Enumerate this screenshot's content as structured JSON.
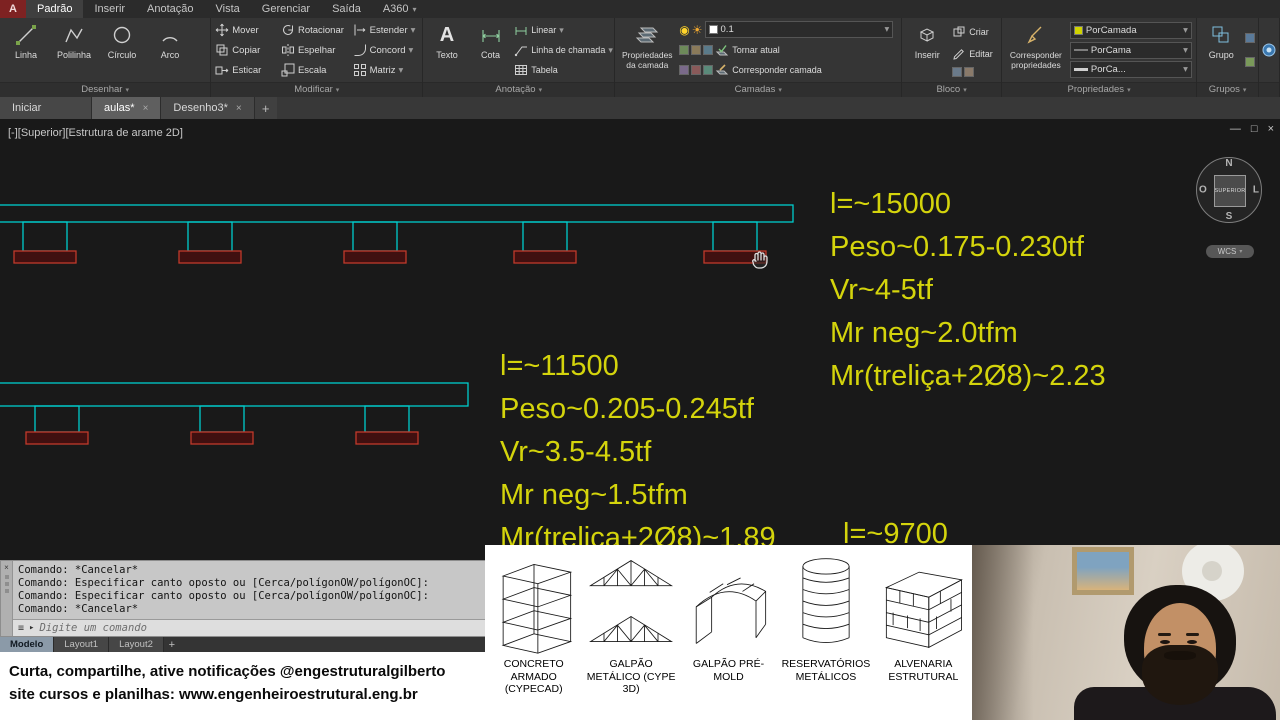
{
  "icons": {
    "close": "×",
    "caret": "▾",
    "minimize": "—",
    "restore": "□",
    "plus": "+"
  },
  "ribbon": {
    "tabs": [
      {
        "label": "Padrão"
      },
      {
        "label": "Inserir"
      },
      {
        "label": "Anotação"
      },
      {
        "label": "Vista"
      },
      {
        "label": "Gerenciar"
      },
      {
        "label": "Saída"
      },
      {
        "label": "A360"
      }
    ],
    "panels": {
      "desenhar": {
        "label": "Desenhar",
        "linha": "Linha",
        "polilinha": "Polilinha",
        "circulo": "Círculo",
        "arco": "Arco"
      },
      "modificar": {
        "label": "Modificar",
        "mover": "Mover",
        "copiar": "Copiar",
        "esticar": "Esticar",
        "rotacionar": "Rotacionar",
        "espelhar": "Espelhar",
        "escala": "Escala",
        "estender": "Estender",
        "concord": "Concord",
        "matriz": "Matriz"
      },
      "anotacao": {
        "label": "Anotação",
        "texto": "Texto",
        "cota": "Cota",
        "linear": "Linear",
        "linha_chamada": "Linha de chamada",
        "tabela": "Tabela"
      },
      "camadas": {
        "label": "Camadas",
        "propriedades_camada": "Propriedades da camada",
        "layer_value": "0.1",
        "tornar_atual": "Tornar atual",
        "corresponder_camada": "Corresponder camada"
      },
      "bloco": {
        "label": "Bloco",
        "inserir": "Inserir",
        "criar": "Criar",
        "editar": "Editar"
      },
      "propriedades": {
        "label": "Propriedades",
        "corresponder_propriedades": "Corresponder propriedades",
        "cor": "PorCamada",
        "tipo_linha": "PorCama",
        "espessura": "PorCa..."
      },
      "grupos": {
        "label": "Grupos",
        "grupo": "Grupo"
      }
    }
  },
  "file_tabs": [
    {
      "label": "Iniciar"
    },
    {
      "label": "aulas*"
    },
    {
      "label": "Desenho3*"
    }
  ],
  "viewport": {
    "collapse": "[-]",
    "view": "[Superior]",
    "visual_style": "[Estrutura de arame 2D]"
  },
  "canvas": {
    "annotations_right": [
      "l=~15000",
      "Peso~0.175-0.230tf",
      "Vr~4-5tf",
      "Mr neg~2.0tfm",
      "Mr(treliça+2Ø8)~2.23"
    ],
    "annotations_mid": [
      "l=~11500",
      "Peso~0.205-0.245tf",
      "Vr~3.5-4.5tf",
      "Mr neg~1.5tfm",
      "Mr(treliça+2Ø8)~1.89"
    ],
    "annotation_bottom": "l=~9700",
    "compass": {
      "n": "N",
      "s": "S",
      "l": "L",
      "o": "O",
      "cube": "SUPERIOR",
      "wcs": "WCS"
    }
  },
  "command": {
    "history": [
      "Comando: *Cancelar*",
      "Comando: Especificar canto oposto ou [Cerca/polígonOW/polígonOC]:",
      "Comando: Especificar canto oposto ou [Cerca/polígonOW/polígonOC]:",
      "Comando: *Cancelar*"
    ],
    "prompt": "Digite um comando"
  },
  "layout_tabs": {
    "modelo": "Modelo",
    "layout1": "Layout1",
    "layout2": "Layout2",
    "add": "+"
  },
  "banner": {
    "line1": "Curta, compartilhe, ative notificações @engestruturalgilberto",
    "line2": "site cursos e planilhas: www.engenheiroestrutural.eng.br"
  },
  "services": [
    {
      "caption": "CONCRETO ARMADO (CYPECAD)"
    },
    {
      "caption": "GALPÃO METÁLICO (CYPE 3D)"
    },
    {
      "caption": "GALPÃO PRÉ-MOLD"
    },
    {
      "caption": "RESERVATÓRIOS METÁLICOS"
    },
    {
      "caption": "ALVENARIA ESTRUTURAL"
    }
  ],
  "colors": {
    "beam": "#00cccc",
    "support_pad": "#c0392b",
    "annotation_text": "#d4d40c",
    "active_layer_swatch": "#d0d400"
  }
}
